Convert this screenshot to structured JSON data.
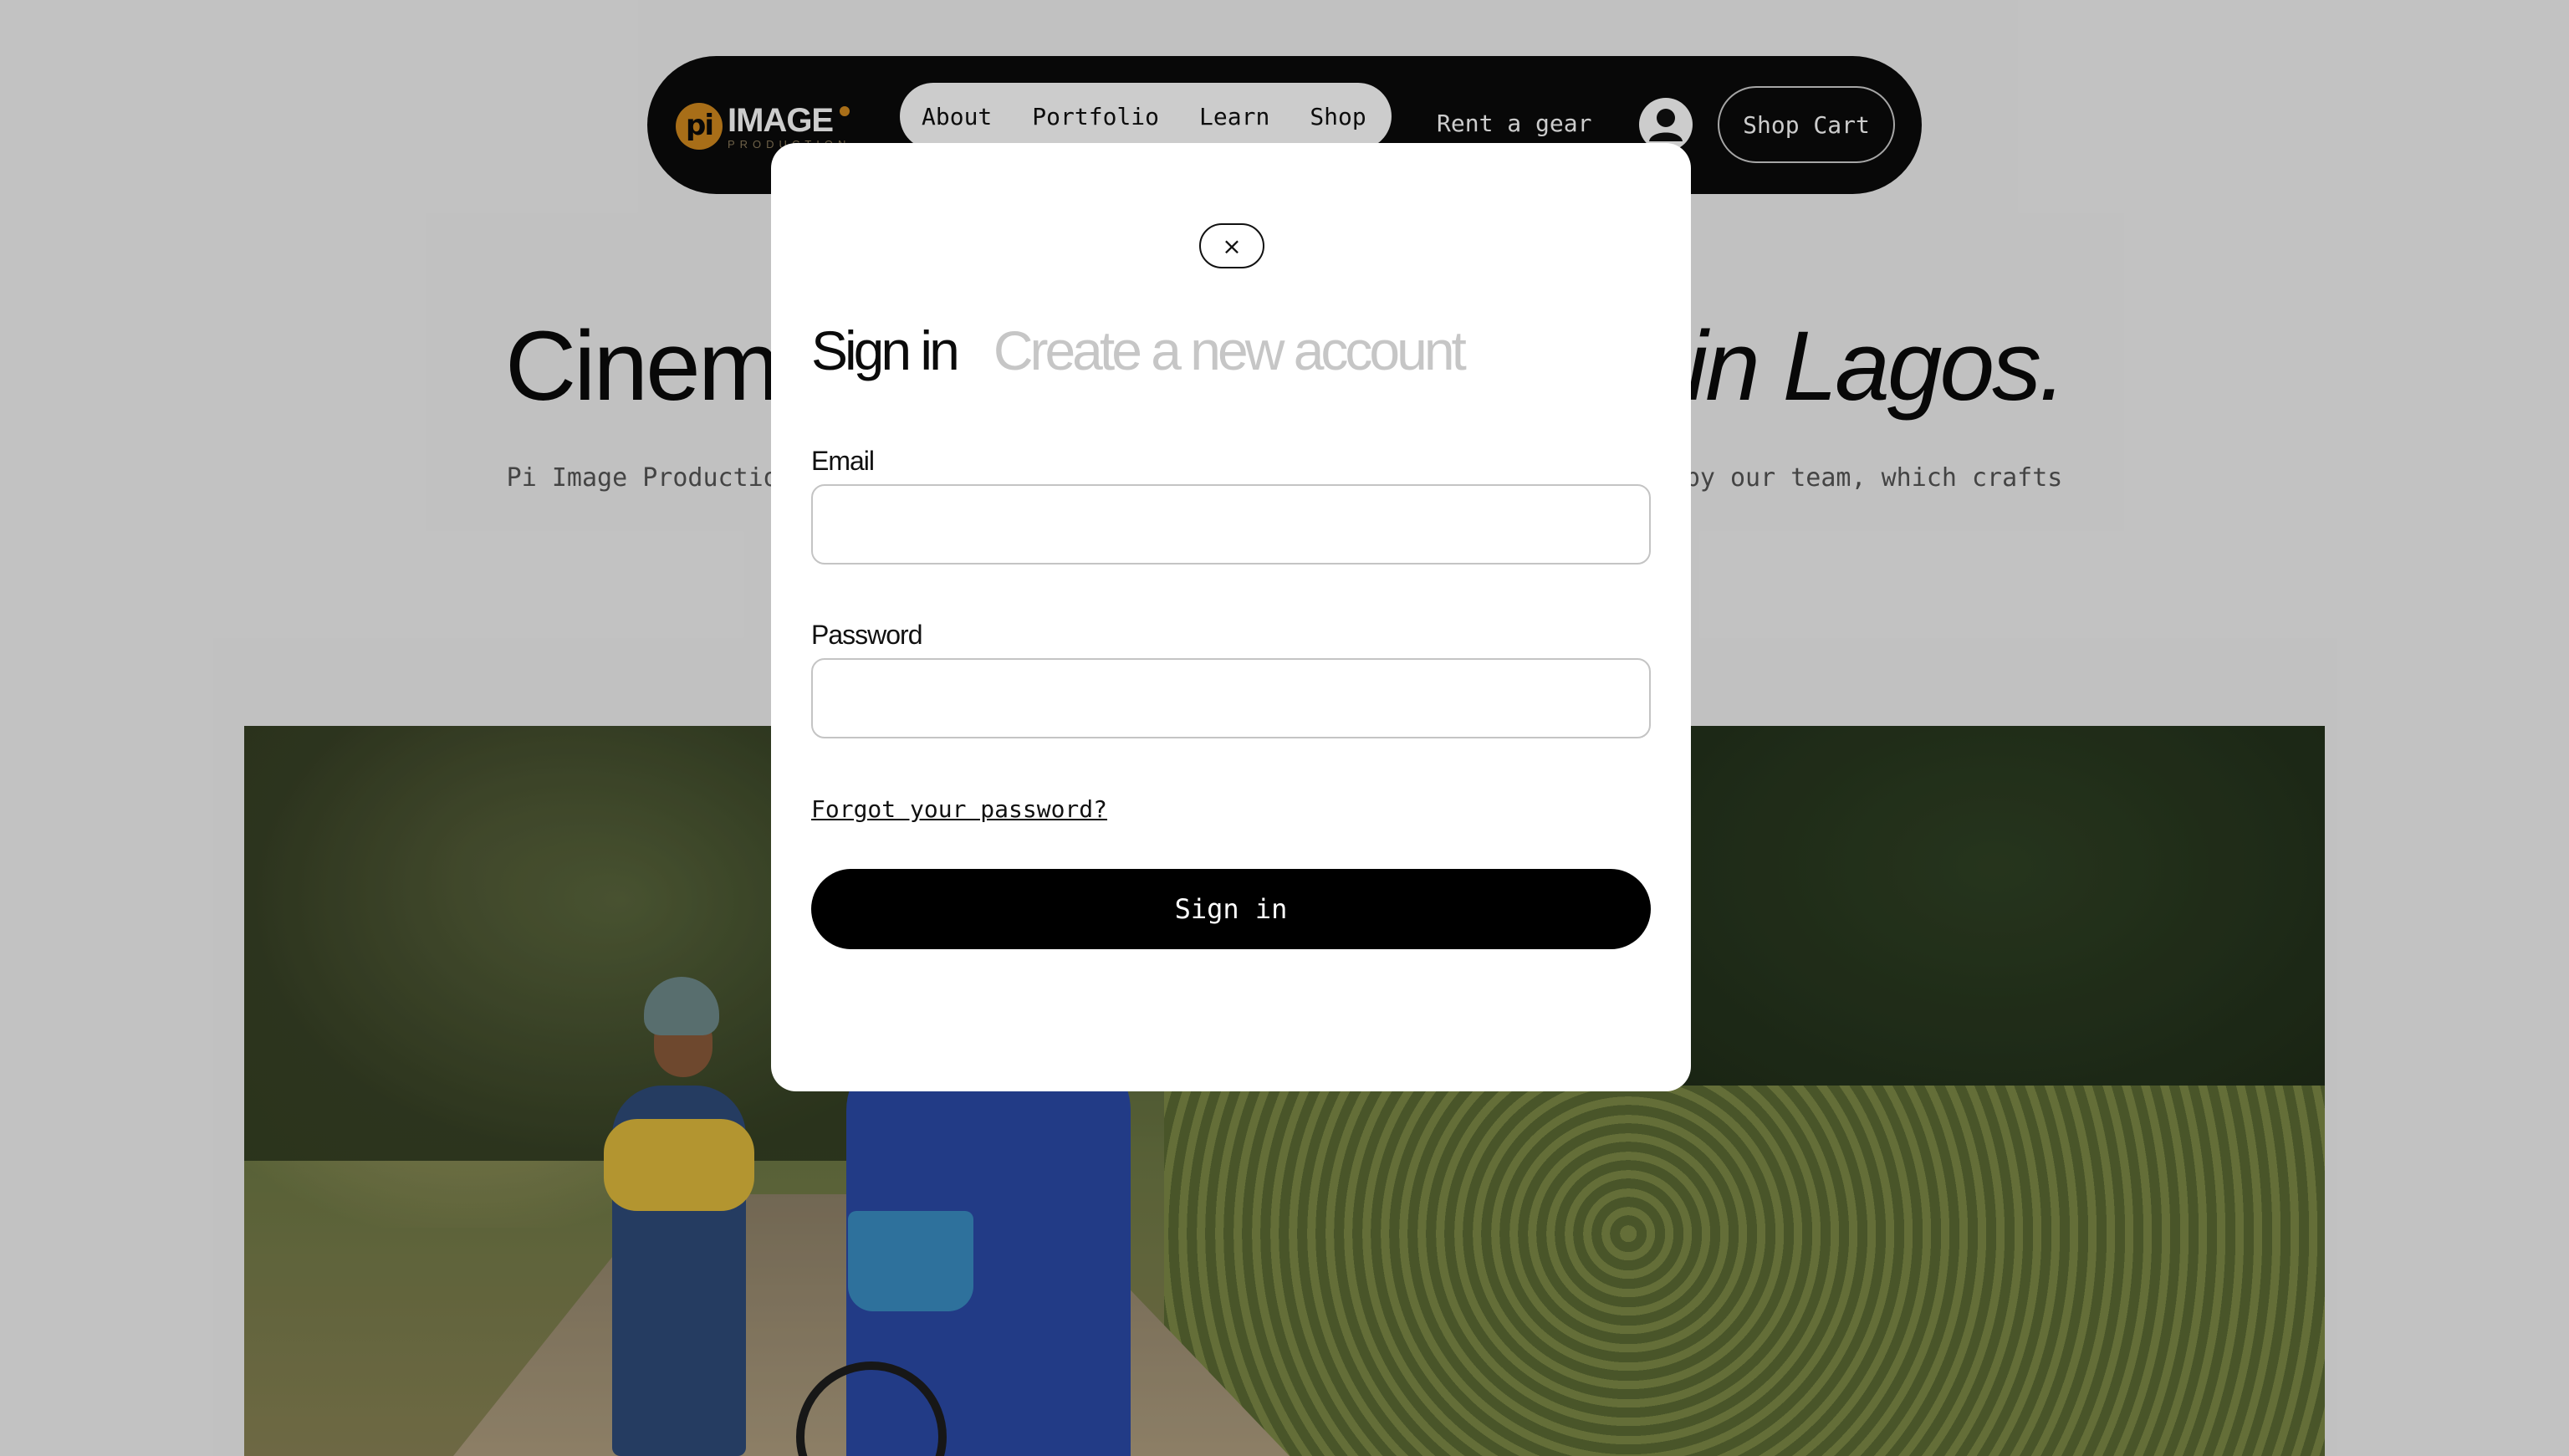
{
  "colors": {
    "nav_bg": "#0b0b0b",
    "logo_accent": "#d38a1f",
    "modal_bg": "#ffffff",
    "primary_button": "#000000",
    "inactive_tab": "#c6c6c6"
  },
  "logo": {
    "mark": "pi",
    "word": "IMAGE",
    "sub": "PRODUCTION"
  },
  "nav": {
    "links": [
      "About",
      "Portfolio",
      "Learn",
      "Shop"
    ],
    "rent_label": "Rent a gear",
    "account_icon": "user-icon",
    "cart_label": "Shop Cart"
  },
  "hero": {
    "title_left": "Cinem",
    "title_right": "in Lagos.",
    "sub_left": "Pi Image Productio",
    "sub_right": "by our team, which crafts"
  },
  "modal": {
    "close_label": "×",
    "close_icon": "close-icon",
    "tabs": [
      "Sign in",
      "Create a new account"
    ],
    "active_tab": "Sign in",
    "email_label": "Email",
    "email_value": "",
    "password_label": "Password",
    "password_value": "",
    "forgot_label": "Forgot your password?",
    "submit_label": "Sign in"
  }
}
